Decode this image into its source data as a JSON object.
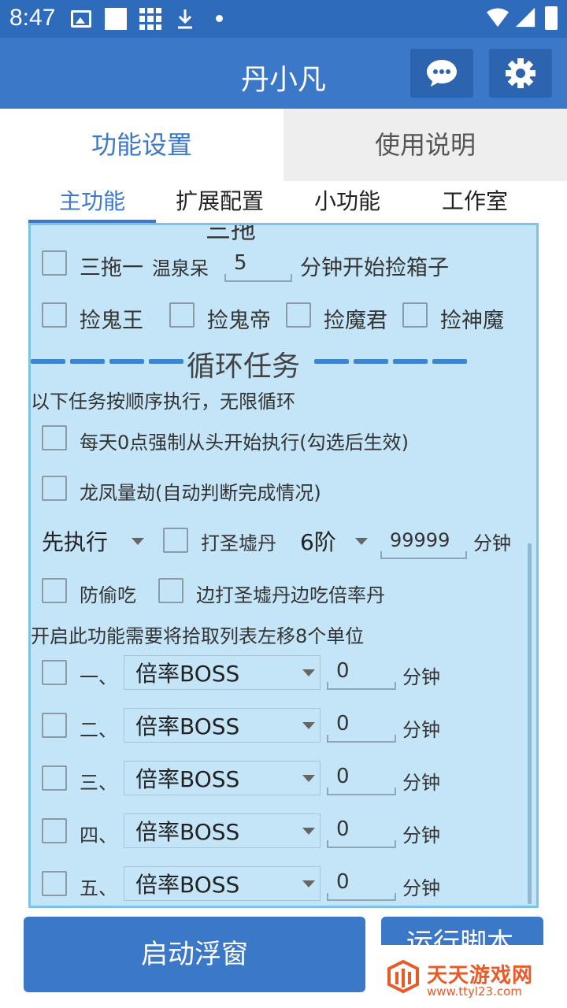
{
  "status_bar": {
    "time": "8:47"
  },
  "app": {
    "title": "丹小凡",
    "chat_icon": "chat-bubble-icon",
    "settings_icon": "gear-icon"
  },
  "top_tabs": [
    {
      "label": "功能设置",
      "active": true
    },
    {
      "label": "使用说明",
      "active": false
    }
  ],
  "sub_tabs": [
    {
      "label": "主功能",
      "active": true
    },
    {
      "label": "扩展配置",
      "active": false
    },
    {
      "label": "小功能",
      "active": false
    },
    {
      "label": "工作室",
      "active": false
    }
  ],
  "panel": {
    "clipped_heading": "三拖",
    "three_drag": {
      "label": "三拖一",
      "sub_label": "温泉呆",
      "minutes": "5",
      "suffix": "分钟开始捡箱子"
    },
    "pickups": [
      "捡鬼王",
      "捡鬼帝",
      "捡魔君",
      "捡神魔"
    ],
    "loop_heading": "循环任务",
    "loop_note": "以下任务按顺序执行，无限循环",
    "daily_reset": "每天0点强制从头开始执行(勾选后生效)",
    "dragon_phoenix": "龙凤量劫(自动判断完成情况)",
    "execute_order": {
      "selected": "先执行"
    },
    "holy_ruins": {
      "label": "打圣墟丹",
      "level": "6阶",
      "minutes": "99999",
      "unit": "分钟"
    },
    "anti_steal": "防偷吃",
    "eat_multiplier": "边打圣墟丹边吃倍率丹",
    "shift_note": "开启此功能需要将拾取列表左移8个单位",
    "tasks": [
      {
        "index": "一、",
        "selected": "倍率BOSS",
        "minutes": "0",
        "unit": "分钟"
      },
      {
        "index": "二、",
        "selected": "倍率BOSS",
        "minutes": "0",
        "unit": "分钟"
      },
      {
        "index": "三、",
        "selected": "倍率BOSS",
        "minutes": "0",
        "unit": "分钟"
      },
      {
        "index": "四、",
        "selected": "倍率BOSS",
        "minutes": "0",
        "unit": "分钟"
      },
      {
        "index": "五、",
        "selected": "倍率BOSS",
        "minutes": "0",
        "unit": "分钟"
      }
    ]
  },
  "bottom": {
    "float_button": "启动浮窗",
    "run_button": "运行脚本"
  },
  "watermark": {
    "text": "天天游戏网",
    "url": "www.ttyl23.com"
  },
  "colors": {
    "primary": "#3c78c8",
    "panel_bg": "#c4e5f7",
    "panel_border": "#7cc3e6",
    "watermark": "#e85a27"
  }
}
